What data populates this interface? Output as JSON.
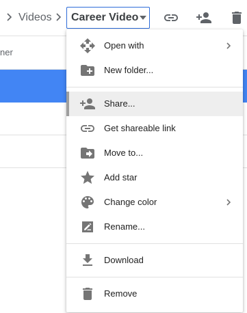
{
  "breadcrumb": {
    "parent": "Videos",
    "current": "Career Video"
  },
  "toolbar": {
    "icons": [
      "link-icon",
      "add-person-icon",
      "trash-icon"
    ]
  },
  "list": {
    "column_header_partial": "ner"
  },
  "menu": {
    "items": [
      {
        "label": "Open with",
        "icon": "move-arrows-icon",
        "submenu": true
      },
      {
        "label": "New folder...",
        "icon": "new-folder-icon",
        "submenu": false
      },
      {
        "label": "Share...",
        "icon": "add-person-icon",
        "submenu": false,
        "active": true
      },
      {
        "label": "Get shareable link",
        "icon": "link-icon",
        "submenu": false
      },
      {
        "label": "Move to...",
        "icon": "move-to-folder-icon",
        "submenu": false
      },
      {
        "label": "Add star",
        "icon": "star-icon",
        "submenu": false
      },
      {
        "label": "Change color",
        "icon": "palette-icon",
        "submenu": true
      },
      {
        "label": "Rename...",
        "icon": "rename-icon",
        "submenu": false
      },
      {
        "label": "Download",
        "icon": "download-icon",
        "submenu": false
      },
      {
        "label": "Remove",
        "icon": "trash-icon",
        "submenu": false
      }
    ]
  },
  "colors": {
    "accent": "#4285f4",
    "breadcrumb_border": "#2d6bd8",
    "icon": "#757575",
    "active_item_bg": "#eeeeee"
  }
}
